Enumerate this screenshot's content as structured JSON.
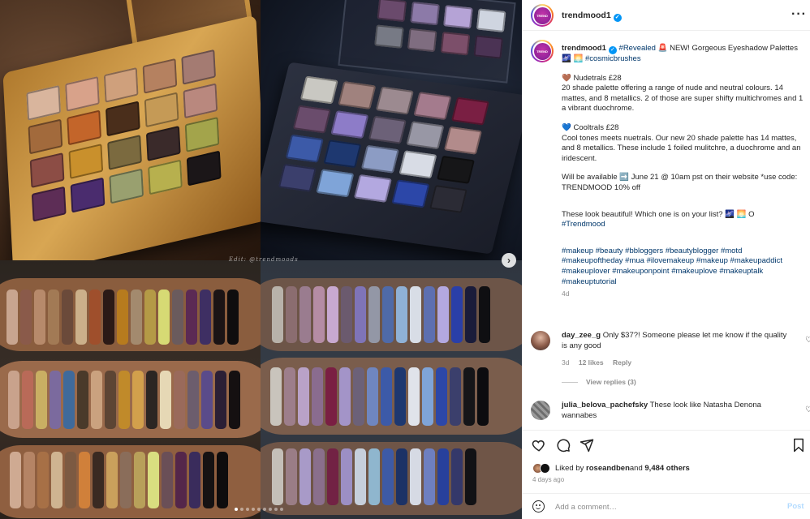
{
  "post": {
    "username": "trendmood1",
    "avatar_text": "TREND",
    "caption": {
      "tag_revealed": "#Revealed",
      "siren": "🚨",
      "intro": " NEW! Gorgeous Eyeshadow Palettes ",
      "emoji_intro": "🌌 🌅",
      "tag_cosmic": "#cosmicbrushes",
      "nudetrals_title": "🤎 Nudetrals £28",
      "nudetrals_desc": "20 shade palette offering a range of nude and neutral colours. 14 mattes, and 8 metallics. 2 of those are super shifty multichromes and 1 a vibrant duochrome.",
      "cooltrals_title": "💙 Cooltrals £28",
      "cooltrals_desc": "Cool tones meets nuetrals. Our new 20 shade palette has 14 mattes, and 8 metallics. These include 1 foiled mulitchre, a duochrome and an iridescent.",
      "availability": "Will be available ➡️ June 21 @ 10am pst on their website *use code: TRENDMOOD 10% off",
      "question": "These look beautiful! Which one is on your list? 🌌 🌅 O",
      "tag_trendmood": "#Trendmood",
      "hashtags": "#makeup #beauty #bbloggers #beautyblogger #motd #makeupoftheday #mua #ilovemakeup #makeup #makeupaddict #makeuplover #makeuponpoint #makeuplove #makeuptalk #makeuptutorial",
      "age": "4d"
    }
  },
  "comments": [
    {
      "username": "day_zee_g",
      "text": "Only $37?! Someone please let me know if the quality is any good",
      "age": "3d",
      "likes": "12 likes",
      "reply": "Reply"
    },
    {
      "username": "julia_belova_pachefsky",
      "text": "These look like Natasha Denona wannabes"
    }
  ],
  "view_replies": "View replies (3)",
  "likes": {
    "prefix": "Liked by ",
    "user": "roseandben",
    "middle": " and ",
    "count": "9,484 others"
  },
  "posted_ago": "4 days ago",
  "add_comment": {
    "placeholder": "Add a comment…",
    "post_label": "Post"
  },
  "media": {
    "watermark": "Edit: @trendmoods",
    "slide_count": 9,
    "active_slide": 1
  },
  "icons": {
    "more": "more-options-icon",
    "verified": "verified-badge-icon",
    "like": "heart-icon",
    "comment": "comment-icon",
    "share": "share-icon",
    "save": "bookmark-icon",
    "emoji": "emoji-icon",
    "next": "chevron-right-icon"
  },
  "colors": {
    "link": "#00376b",
    "verified": "#0095f6",
    "post_disabled": "#b3dbff",
    "muted": "#8e8e8e"
  }
}
